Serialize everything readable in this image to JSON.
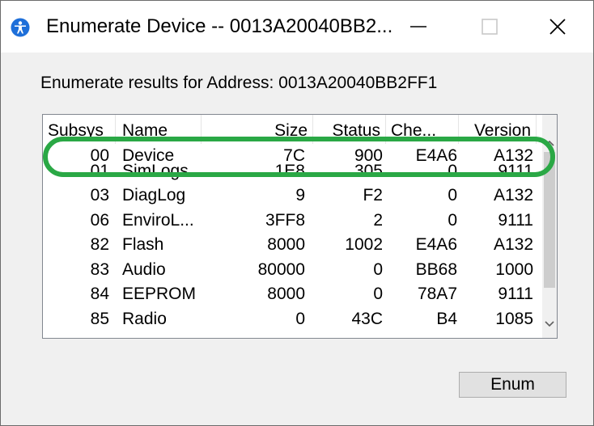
{
  "window": {
    "title": "Enumerate Device -- 0013A20040BB2...",
    "app_icon": "person-accessibility-icon",
    "controls": [
      "minimize-icon",
      "maximize-icon",
      "close-icon"
    ]
  },
  "label": "Enumerate results for Address: 0013A20040BB2FF1",
  "table": {
    "headers": [
      "Subsys",
      "Name",
      "Size",
      "Status",
      "Che...",
      "Version"
    ],
    "rows": [
      {
        "subsys": "00",
        "name": "Device",
        "size": "7C",
        "status": "900",
        "checksum": "E4A6",
        "version": "A132"
      },
      {
        "subsys": "01",
        "name": "SimLogs",
        "size": "1E8",
        "status": "305",
        "checksum": "0",
        "version": "9111"
      },
      {
        "subsys": "03",
        "name": "DiagLog",
        "size": "9",
        "status": "F2",
        "checksum": "0",
        "version": "A132"
      },
      {
        "subsys": "06",
        "name": "EnviroL...",
        "size": "3FF8",
        "status": "2",
        "checksum": "0",
        "version": "9111"
      },
      {
        "subsys": "82",
        "name": "Flash",
        "size": "8000",
        "status": "1002",
        "checksum": "E4A6",
        "version": "A132"
      },
      {
        "subsys": "83",
        "name": "Audio",
        "size": "80000",
        "status": "0",
        "checksum": "BB68",
        "version": "1000"
      },
      {
        "subsys": "84",
        "name": "EEPROM",
        "size": "8000",
        "status": "0",
        "checksum": "78A7",
        "version": "9111"
      },
      {
        "subsys": "85",
        "name": "Radio",
        "size": "0",
        "status": "43C",
        "checksum": "B4",
        "version": "1085"
      }
    ]
  },
  "button": {
    "label": "Enum"
  },
  "colors": {
    "highlight": "#2aa845",
    "app_icon": "#1e6fd9"
  }
}
